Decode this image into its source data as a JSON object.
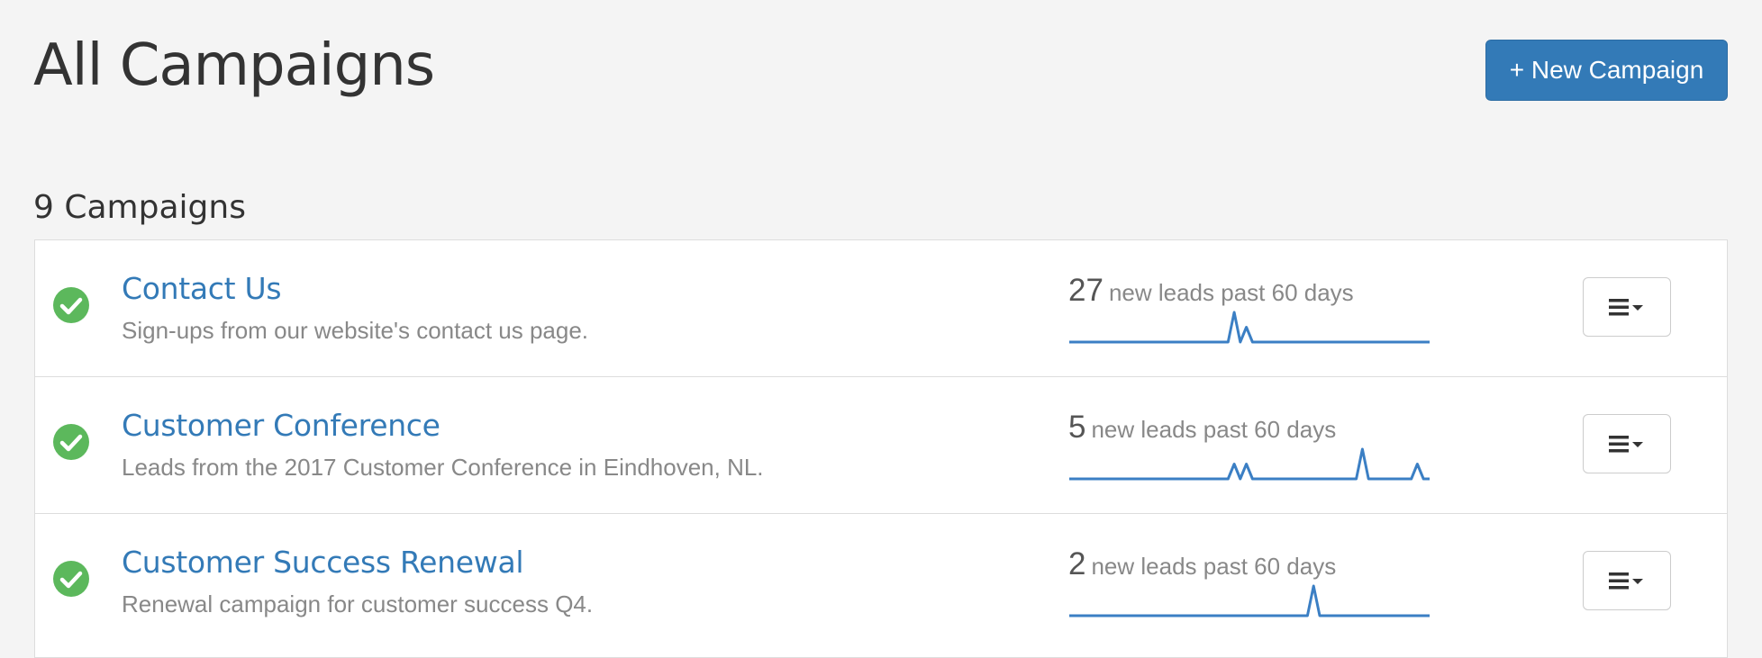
{
  "page": {
    "title": "All Campaigns",
    "new_button_label": "+ New Campaign",
    "count_heading": "9 Campaigns"
  },
  "colors": {
    "accent": "#337ab7",
    "success": "#5cb85c",
    "sparkline": "#3b7fc4"
  },
  "campaigns": [
    {
      "name": "Contact Us",
      "description": "Sign-ups from our website's contact us page.",
      "lead_count": "27",
      "leads_label": "new leads past 60 days",
      "status_icon": "check-circle-icon",
      "menu_icon": "hamburger-caret-icon",
      "daily_leads": [
        0,
        0,
        0,
        0,
        0,
        0,
        0,
        0,
        0,
        0,
        0,
        0,
        0,
        0,
        0,
        0,
        0,
        0,
        0,
        0,
        0,
        0,
        0,
        0,
        0,
        0,
        0,
        24,
        0,
        2,
        0,
        0,
        0,
        0,
        0,
        0,
        0,
        0,
        0,
        0,
        0,
        0,
        0,
        0,
        0,
        0,
        0,
        0,
        0,
        0,
        0,
        0,
        0,
        0,
        0,
        0,
        0,
        0,
        0,
        0
      ]
    },
    {
      "name": "Customer Conference",
      "description": "Leads from the 2017 Customer Conference in Eindhoven, NL.",
      "lead_count": "5",
      "leads_label": "new leads past 60 days",
      "status_icon": "check-circle-icon",
      "menu_icon": "hamburger-caret-icon",
      "daily_leads": [
        0,
        0,
        0,
        0,
        0,
        0,
        0,
        0,
        0,
        0,
        0,
        0,
        0,
        0,
        0,
        0,
        0,
        0,
        0,
        0,
        0,
        0,
        0,
        0,
        0,
        0,
        0,
        1,
        0,
        1,
        0,
        0,
        0,
        0,
        0,
        0,
        0,
        0,
        0,
        0,
        0,
        0,
        0,
        0,
        0,
        0,
        0,
        0,
        2,
        0,
        0,
        0,
        0,
        0,
        0,
        0,
        0,
        1,
        0,
        0
      ]
    },
    {
      "name": "Customer Success Renewal",
      "description": "Renewal campaign for customer success Q4.",
      "lead_count": "2",
      "leads_label": "new leads past 60 days",
      "status_icon": "check-circle-icon",
      "menu_icon": "hamburger-caret-icon",
      "daily_leads": [
        0,
        0,
        0,
        0,
        0,
        0,
        0,
        0,
        0,
        0,
        0,
        0,
        0,
        0,
        0,
        0,
        0,
        0,
        0,
        0,
        0,
        0,
        0,
        0,
        0,
        0,
        0,
        0,
        0,
        0,
        0,
        0,
        0,
        0,
        0,
        0,
        0,
        0,
        0,
        0,
        2,
        0,
        0,
        0,
        0,
        0,
        0,
        0,
        0,
        0,
        0,
        0,
        0,
        0,
        0,
        0,
        0,
        0,
        0,
        0
      ]
    }
  ]
}
